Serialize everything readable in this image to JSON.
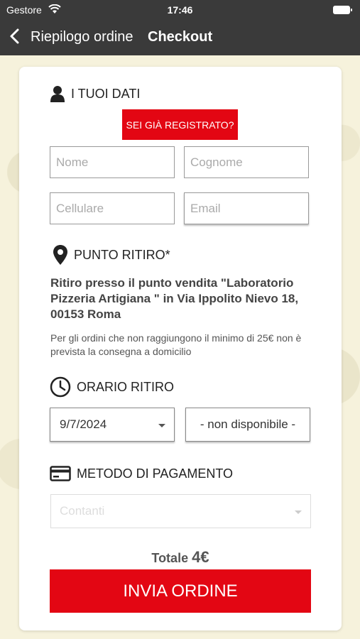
{
  "status_bar": {
    "carrier": "Gestore",
    "time": "17:46"
  },
  "nav": {
    "back_label": "Riepilogo ordine",
    "title": "Checkout"
  },
  "sections": {
    "user_data": {
      "title": "I TUOI DATI",
      "register_button": "SEI GIÀ REGISTRATO?",
      "fields": {
        "first_name_placeholder": "Nome",
        "last_name_placeholder": "Cognome",
        "phone_placeholder": "Cellulare",
        "email_placeholder": "Email"
      }
    },
    "pickup_point": {
      "title": "PUNTO RITIRO*",
      "address_text": "Ritiro presso il punto vendita \"Laboratorio Pizzeria Artigiana \" in Via Ippolito Nievo 18, 00153 Roma",
      "note": "Per gli ordini che non raggiungono il minimo di 25€ non è prevista la consegna a domicilio"
    },
    "pickup_time": {
      "title": "ORARIO RITIRO",
      "date_value": "9/7/2024",
      "time_value": "- non disponibile -"
    },
    "payment": {
      "title": "METODO DI PAGAMENTO",
      "method_value": "Contanti"
    }
  },
  "total": {
    "label": "Totale",
    "amount": "4€"
  },
  "submit_button": "INVIA ORDINE",
  "colors": {
    "accent": "#e30613",
    "header_bg": "#3a3a3a",
    "page_bg": "#f6f2dc"
  },
  "icons": [
    "wifi-icon",
    "battery-icon",
    "back-chevron-icon",
    "user-icon",
    "location-pin-icon",
    "clock-icon",
    "credit-card-icon",
    "dropdown-caret-icon"
  ]
}
